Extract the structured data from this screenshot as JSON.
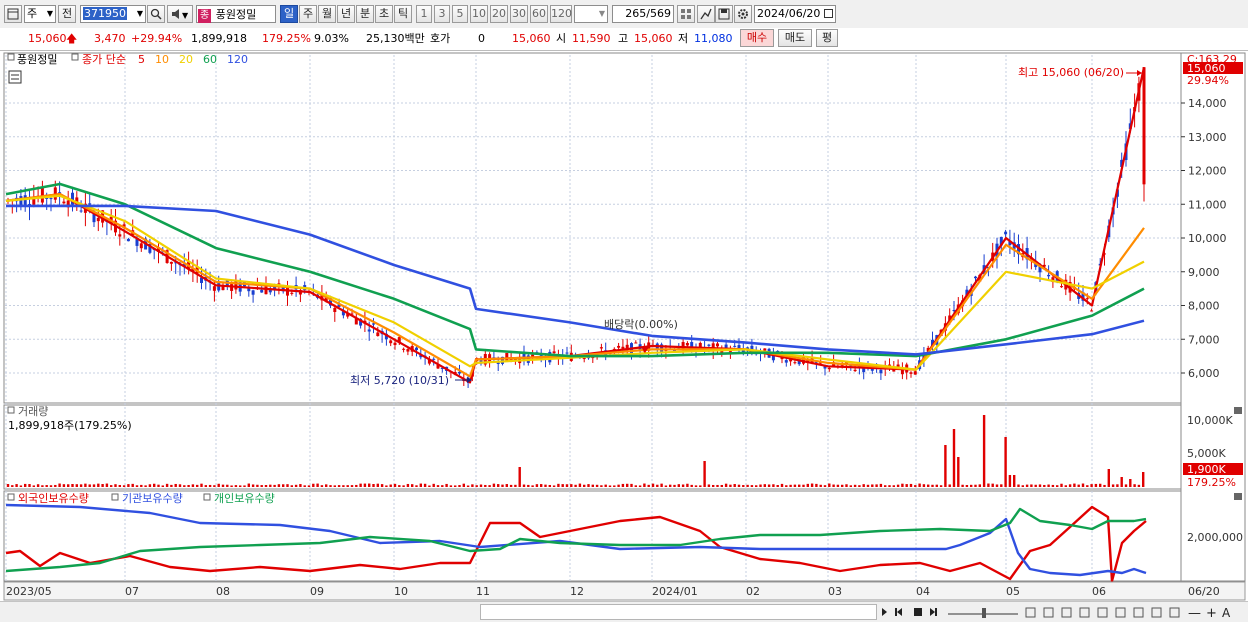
{
  "toolbar": {
    "stock_type": "주",
    "prev_label": "전",
    "code": "371950",
    "stock_badge": "종",
    "stock_name": "풍원정밀",
    "periods": [
      "일",
      "주",
      "월",
      "년",
      "분",
      "초",
      "틱"
    ],
    "active_period": "일",
    "intervals": [
      "1",
      "3",
      "5",
      "10",
      "20",
      "30",
      "60",
      "120"
    ],
    "count_current": "265",
    "count_total": "/569",
    "date": "2024/06/20"
  },
  "quote": {
    "price": "15,060",
    "change": "3,470",
    "change_pct": "+29.94%",
    "volume": "1,899,918",
    "volume_ratio": "179.25%",
    "turnover": "9.03%",
    "amount": "25,130백만",
    "hoga_label": "호가",
    "hoga_value": "0",
    "hoga_price": "15,060",
    "open_label": "시",
    "open": "11,590",
    "high_label": "고",
    "high": "15,060",
    "low_label": "저",
    "low": "11,080",
    "buy_label": "매수",
    "sell_label": "매도",
    "flat_label": "평"
  },
  "price_panel": {
    "name": "풍원정밀",
    "ma_label": "종가 단순",
    "ma_periods": [
      {
        "label": "5",
        "color": "#e00000"
      },
      {
        "label": "10",
        "color": "#ff8c00"
      },
      {
        "label": "20",
        "color": "#f0d000"
      },
      {
        "label": "60",
        "color": "#10a050"
      },
      {
        "label": "120",
        "color": "#3050e0"
      }
    ],
    "y_ticks": [
      "14,000",
      "13,000",
      "12,000",
      "11,000",
      "10,000",
      "9,000",
      "8,000",
      "7,000",
      "6,000"
    ],
    "top_info": "C:163.29",
    "price_tag": "15,060",
    "pct_tag": "29.94%",
    "high_annotation": "최고 15,060 (06/20)",
    "low_annotation": "최저 5,720 (10/31)",
    "dividend_annotation": "배당락(0.00%)"
  },
  "volume_panel": {
    "title": "거래량",
    "info": "1,899,918주(179.25%)",
    "y_ticks": [
      "10,000K",
      "5,000K"
    ],
    "tag_value": "1,900K",
    "tag_pct": "179.25%"
  },
  "holdings_panel": {
    "legend": [
      {
        "label": "외국인보유수량",
        "color": "#e00000"
      },
      {
        "label": "기관보유수량",
        "color": "#3050e0"
      },
      {
        "label": "개인보유수량",
        "color": "#10a050"
      }
    ],
    "y_tick": "2,000,000"
  },
  "x_axis": {
    "labels": [
      "2023/05",
      "07",
      "08",
      "09",
      "10",
      "11",
      "12",
      "2024/01",
      "02",
      "03",
      "04",
      "05",
      "06"
    ],
    "right_label": "06/20"
  },
  "chart_data": {
    "type": "line",
    "x": [
      "2023-05",
      "2023-06",
      "2023-07",
      "2023-08",
      "2023-09",
      "2023-10",
      "2023-10-31",
      "2023-11",
      "2023-12",
      "2024-01",
      "2024-02",
      "2024-03",
      "2024-04",
      "2024-05",
      "2024-06",
      "2024-06-20"
    ],
    "series": [
      {
        "name": "5",
        "values": [
          11100,
          11300,
          10200,
          8600,
          8400,
          7000,
          5720,
          6400,
          6500,
          6800,
          6700,
          6200,
          6100,
          10000,
          8000,
          15060
        ]
      },
      {
        "name": "10",
        "values": [
          11100,
          11300,
          10300,
          8700,
          8500,
          7200,
          5900,
          6400,
          6500,
          6700,
          6700,
          6300,
          6100,
          9800,
          8200,
          10300
        ]
      },
      {
        "name": "20",
        "values": [
          11100,
          11250,
          10500,
          8800,
          8500,
          7500,
          6200,
          6300,
          6450,
          6600,
          6700,
          6400,
          6100,
          9000,
          8500,
          9300
        ]
      },
      {
        "name": "60",
        "values": [
          11300,
          11600,
          11000,
          9700,
          9000,
          8200,
          7300,
          6700,
          6500,
          6500,
          6600,
          6600,
          6500,
          7000,
          7700,
          8500
        ]
      },
      {
        "name": "120",
        "values": [
          10950,
          10950,
          10950,
          10800,
          10100,
          9200,
          8500,
          7900,
          7500,
          7100,
          6900,
          6700,
          6550,
          6850,
          7150,
          7550
        ]
      }
    ],
    "ylim": [
      5500,
      15300
    ]
  }
}
